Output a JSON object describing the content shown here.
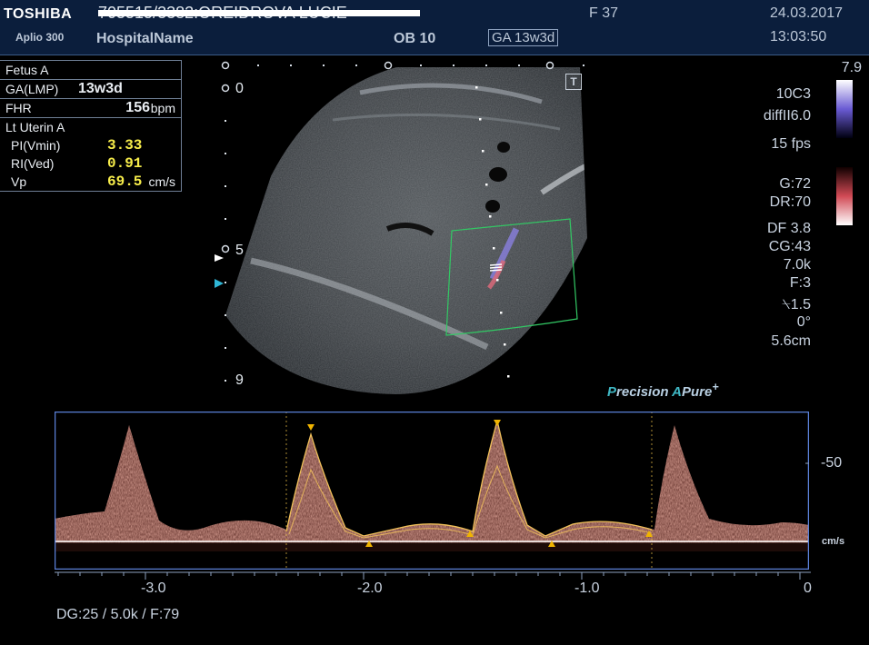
{
  "header": {
    "brand": "TOSHIBA",
    "model": "Aplio 300",
    "patient": "705515/3382:OREIDROVA LUCIE",
    "hospital": "HospitalName",
    "sex_age": "F  37",
    "preset": "OB 10",
    "ga": "GA  13w3d",
    "date": "24.03.2017",
    "time": "13:03:50"
  },
  "measurements": {
    "fetus_label": "Fetus A",
    "ga_label": "GA(LMP)",
    "ga_value": "13w3d",
    "fhr_label": "FHR",
    "fhr_value": "156",
    "fhr_unit": "bpm",
    "vessel_label": "Lt Uterin A",
    "pi_label": "PI(Vmin)",
    "pi_value": "3.33",
    "ri_label": "RI(Ved)",
    "ri_value": "0.91",
    "vp_label": "Vp",
    "vp_value": "69.5",
    "vp_unit": "cm/s"
  },
  "settings": {
    "scale_top": "7.9",
    "probe": "10C3",
    "mode": "diffII6.0",
    "fps": "15 fps",
    "gain": "G:72",
    "dr": "DR:70",
    "df": "DF 3.8",
    "cg": "CG:43",
    "prf": "7.0k",
    "filter": "F:3",
    "angle_corr": "1.5",
    "angle": "0°",
    "depth": "5.6cm"
  },
  "image": {
    "depth_labels": [
      "0",
      "5",
      "9"
    ],
    "brand_a": "P",
    "brand_b": "recision",
    "brand_c": "A",
    "brand_d": "Pure",
    "brand_e": "+"
  },
  "doppler": {
    "x_ticks": [
      "-3.0",
      "-2.0",
      "-1.0",
      "0"
    ],
    "y_tick": "-50",
    "unit": "cm/s",
    "footer": "DG:25   / 5.0k     / F:79"
  },
  "colors": {
    "header_bg": "#0b1e3c",
    "measure_value": "#f6ec4a",
    "doppler_frame": "#5a7fd6",
    "color_box": "#32c864",
    "caliper": "#f0b400"
  }
}
